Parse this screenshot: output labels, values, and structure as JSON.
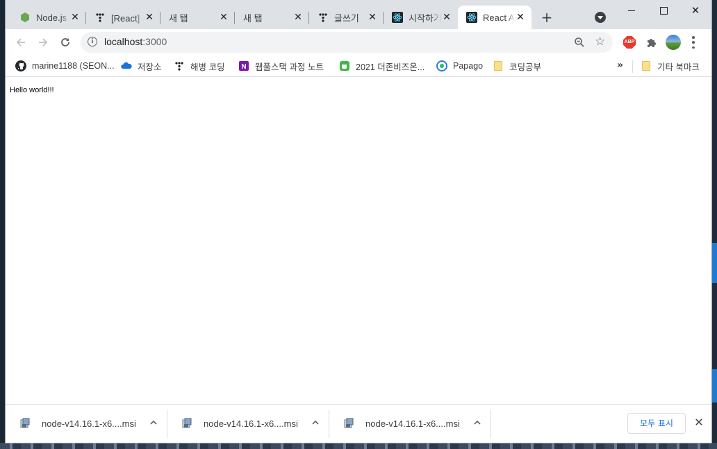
{
  "tabs": [
    {
      "title": "Node.js",
      "icon": "nodejs-icon",
      "active": false
    },
    {
      "title": "[React] 기초",
      "icon": "velog-icon",
      "active": false
    },
    {
      "title": "새 탭",
      "icon": "",
      "active": false
    },
    {
      "title": "새 탭",
      "icon": "",
      "active": false
    },
    {
      "title": "글쓰기",
      "icon": "velog-icon",
      "active": false
    },
    {
      "title": "시작하기",
      "icon": "react-icon",
      "active": false
    },
    {
      "title": "React App",
      "icon": "react-icon",
      "active": true
    }
  ],
  "window_controls": {
    "minimize": "",
    "maximize": "",
    "close": "✕"
  },
  "toolbar": {
    "url_host": "localhost",
    "url_rest": ":3000",
    "abp_label": "ABP"
  },
  "bookmarks": [
    {
      "label": "marine1188 (SEON...",
      "icon": "github-icon"
    },
    {
      "label": "저장소",
      "icon": "onedrive-icon"
    },
    {
      "label": "해병 코딩",
      "icon": "velog-icon"
    },
    {
      "label": "웹풀스택 과정 노트",
      "icon": "onenote-icon"
    },
    {
      "label": "2021 더존비즈온...",
      "icon": "cup-icon"
    },
    {
      "label": "Papago",
      "icon": "papago-icon"
    },
    {
      "label": "코딩공부",
      "icon": "folder-icon"
    }
  ],
  "bookmarks_overflow": "»",
  "other_bookmarks": "기타 북마크",
  "page": {
    "text": "Hello world!!!"
  },
  "downloads": [
    {
      "filename": "node-v14.16.1-x6....msi"
    },
    {
      "filename": "node-v14.16.1-x6....msi"
    },
    {
      "filename": "node-v14.16.1-x6....msi"
    }
  ],
  "shelf": {
    "show_all": "모두 표시",
    "close": "✕"
  },
  "colors": {
    "tabstrip": "#dee1e6",
    "omnibox": "#f1f3f4",
    "accent": "#1a73e8",
    "abp": "#e7392b"
  }
}
